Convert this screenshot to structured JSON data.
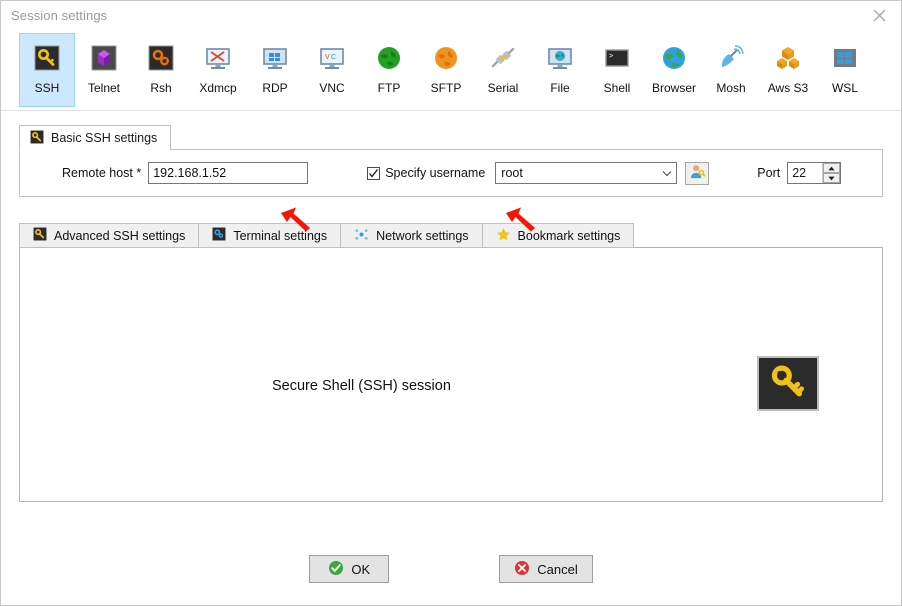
{
  "window": {
    "title": "Session settings",
    "close_icon": "close-icon"
  },
  "session_types": [
    {
      "label": "SSH",
      "icon": "ssh-key-icon",
      "selected": true
    },
    {
      "label": "Telnet",
      "icon": "telnet-cube-icon",
      "selected": false
    },
    {
      "label": "Rsh",
      "icon": "rsh-gears-icon",
      "selected": false
    },
    {
      "label": "Xdmcp",
      "icon": "xdmcp-monitor-icon",
      "selected": false
    },
    {
      "label": "RDP",
      "icon": "rdp-monitor-icon",
      "selected": false
    },
    {
      "label": "VNC",
      "icon": "vnc-monitor-icon",
      "selected": false
    },
    {
      "label": "FTP",
      "icon": "ftp-globe-icon",
      "selected": false
    },
    {
      "label": "SFTP",
      "icon": "sftp-globe-icon",
      "selected": false
    },
    {
      "label": "Serial",
      "icon": "serial-plug-icon",
      "selected": false
    },
    {
      "label": "File",
      "icon": "file-monitor-icon",
      "selected": false
    },
    {
      "label": "Shell",
      "icon": "shell-console-icon",
      "selected": false
    },
    {
      "label": "Browser",
      "icon": "browser-globe-icon",
      "selected": false
    },
    {
      "label": "Mosh",
      "icon": "mosh-dish-icon",
      "selected": false
    },
    {
      "label": "Aws S3",
      "icon": "aws-s3-boxes-icon",
      "selected": false
    },
    {
      "label": "WSL",
      "icon": "wsl-windows-icon",
      "selected": false
    }
  ],
  "basic_settings": {
    "tab_label": "Basic SSH settings",
    "tab_icon": "ssh-key-icon",
    "remote_host_label": "Remote host *",
    "remote_host_value": "192.168.1.52",
    "remote_host_placeholder": "",
    "specify_username_label": "Specify username",
    "specify_username_checked": true,
    "username_value": "root",
    "username_placeholder": "",
    "user_picker_icon": "user-key-icon",
    "port_label": "Port",
    "port_value": "22"
  },
  "sub_tabs": [
    {
      "label": "Advanced SSH settings",
      "icon": "ssh-key-icon",
      "active": false
    },
    {
      "label": "Terminal settings",
      "icon": "terminal-gear-icon",
      "active": false
    },
    {
      "label": "Network settings",
      "icon": "network-dots-icon",
      "active": false
    },
    {
      "label": "Bookmark settings",
      "icon": "star-icon",
      "active": false
    }
  ],
  "panel": {
    "description": "Secure Shell (SSH) session",
    "badge_icon": "ssh-key-icon"
  },
  "footer": {
    "ok_label": "OK",
    "ok_icon": "check-circle-icon",
    "cancel_label": "Cancel",
    "cancel_icon": "x-circle-icon"
  },
  "annotations": {
    "arrow_color": "#fa1405",
    "arrow_host_target": "remote-host-input",
    "arrow_username_target": "username-combo"
  },
  "colors": {
    "selection": "#cce8ff",
    "accent_yellow": "#f0c01a",
    "ok_green": "#3aa83a",
    "cancel_red": "#e03232"
  }
}
